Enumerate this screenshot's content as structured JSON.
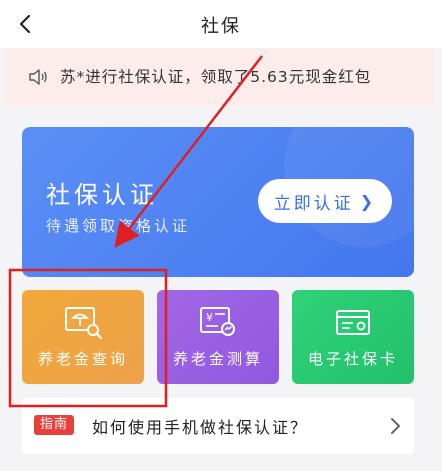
{
  "header": {
    "title": "社保"
  },
  "notice": {
    "text": "苏*进行社保认证，领取了5.63元现金红包"
  },
  "banner": {
    "title": "社保认证",
    "subtitle": "待遇领取资格认证",
    "button_label": "立即认证",
    "button_arrow": "❯"
  },
  "tiles": [
    {
      "label": "养老金查询",
      "icon": "pension-query-icon"
    },
    {
      "label": "养老金测算",
      "icon": "pension-calc-icon"
    },
    {
      "label": "电子社保卡",
      "icon": "e-social-card-icon"
    }
  ],
  "guide": {
    "badge": "指南",
    "text": "如何使用手机做社保认证？"
  },
  "colors": {
    "banner": "#4f84f2",
    "pension_tile": "#efa540",
    "calc_tile": "#9a60e3",
    "card_tile": "#29c972",
    "annotation": "#e02020",
    "badge": "#e8403b"
  }
}
